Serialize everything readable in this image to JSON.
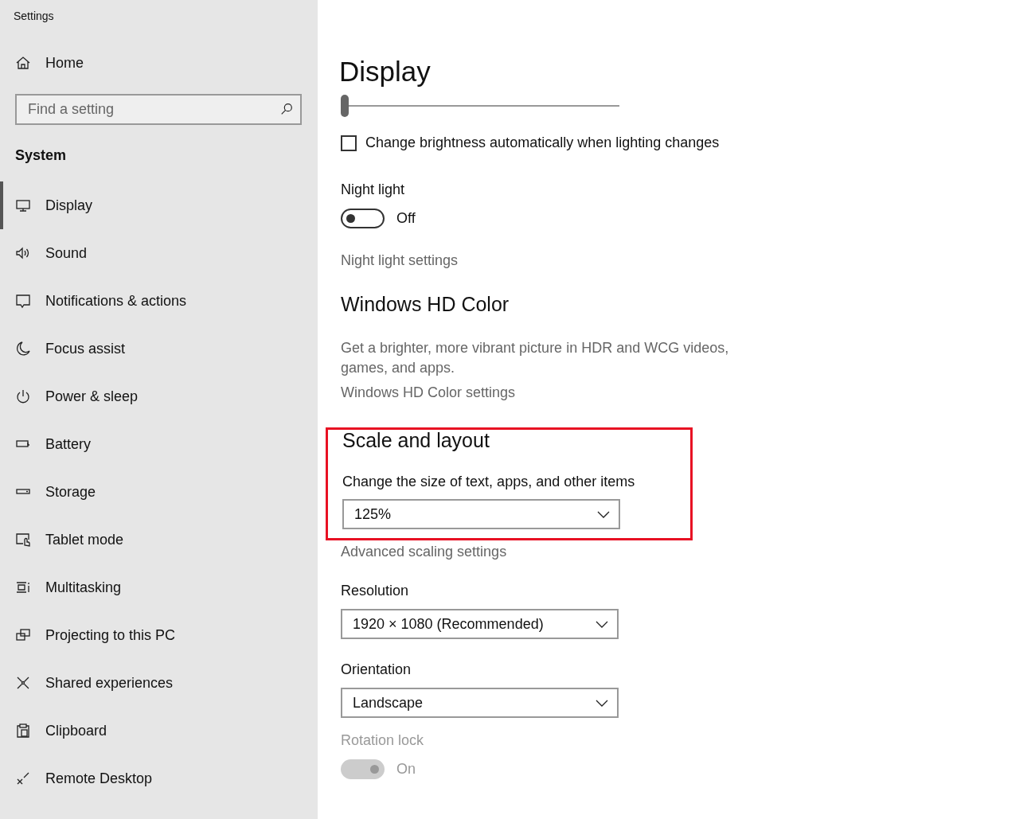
{
  "window": {
    "title": "Settings"
  },
  "sidebar": {
    "home": "Home",
    "search": {
      "placeholder": "Find a setting"
    },
    "section": "System",
    "items": [
      {
        "label": "Display",
        "selected": true
      },
      {
        "label": "Sound",
        "selected": false
      },
      {
        "label": "Notifications & actions",
        "selected": false
      },
      {
        "label": "Focus assist",
        "selected": false
      },
      {
        "label": "Power & sleep",
        "selected": false
      },
      {
        "label": "Battery",
        "selected": false
      },
      {
        "label": "Storage",
        "selected": false
      },
      {
        "label": "Tablet mode",
        "selected": false
      },
      {
        "label": "Multitasking",
        "selected": false
      },
      {
        "label": "Projecting to this PC",
        "selected": false
      },
      {
        "label": "Shared experiences",
        "selected": false
      },
      {
        "label": "Clipboard",
        "selected": false
      },
      {
        "label": "Remote Desktop",
        "selected": false
      }
    ]
  },
  "page": {
    "title": "Display",
    "brightness": {
      "level": 0
    },
    "auto_brightness": {
      "label": "Change brightness automatically when lighting changes",
      "checked": false
    },
    "night_light": {
      "label": "Night light",
      "on": false,
      "state": "Off",
      "disabled": false
    },
    "night_light_link": "Night light settings",
    "hd_color": {
      "heading": "Windows HD Color",
      "description": "Get a brighter, more vibrant picture in HDR and WCG videos, games, and apps.",
      "link": "Windows HD Color settings"
    },
    "scale": {
      "heading": "Scale and layout",
      "highlighted": true,
      "label": "Change the size of text, apps, and other items",
      "value": "125%"
    },
    "advanced_link": "Advanced scaling settings",
    "resolution": {
      "label": "Resolution",
      "value": "1920 × 1080 (Recommended)"
    },
    "orientation": {
      "label": "Orientation",
      "value": "Landscape"
    },
    "rotation_lock": {
      "label": "Rotation lock",
      "on": true,
      "state": "On",
      "disabled": true
    }
  }
}
